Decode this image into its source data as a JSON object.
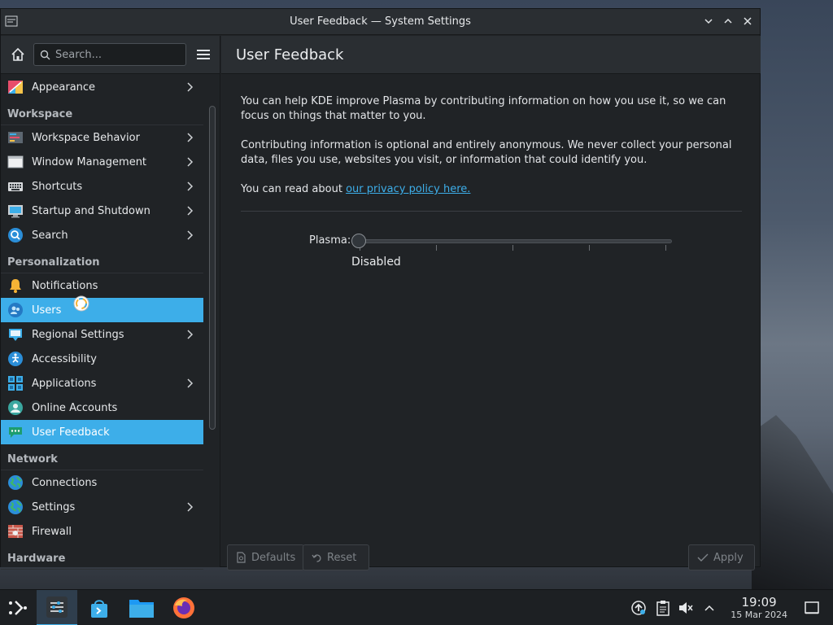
{
  "window": {
    "title": "User Feedback — System Settings"
  },
  "sidebar": {
    "search_placeholder": "Search...",
    "items": [
      {
        "label": "Appearance",
        "icon": "appearance-icon",
        "chevron": true
      },
      {
        "section": "Workspace"
      },
      {
        "label": "Workspace Behavior",
        "icon": "workspace-behavior-icon",
        "chevron": true
      },
      {
        "label": "Window Management",
        "icon": "window-management-icon",
        "chevron": true
      },
      {
        "label": "Shortcuts",
        "icon": "keyboard-icon",
        "chevron": true
      },
      {
        "label": "Startup and Shutdown",
        "icon": "startup-icon",
        "chevron": true
      },
      {
        "label": "Search",
        "icon": "search-icon",
        "chevron": true
      },
      {
        "section": "Personalization"
      },
      {
        "label": "Notifications",
        "icon": "bell-icon",
        "chevron": false
      },
      {
        "label": "Users",
        "icon": "users-icon",
        "chevron": false,
        "highlight": true
      },
      {
        "label": "Regional Settings",
        "icon": "regional-icon",
        "chevron": true
      },
      {
        "label": "Accessibility",
        "icon": "accessibility-icon",
        "chevron": false
      },
      {
        "label": "Applications",
        "icon": "applications-icon",
        "chevron": true
      },
      {
        "label": "Online Accounts",
        "icon": "online-accounts-icon",
        "chevron": false
      },
      {
        "label": "User Feedback",
        "icon": "user-feedback-icon",
        "chevron": false,
        "selected": true
      },
      {
        "section": "Network"
      },
      {
        "label": "Connections",
        "icon": "globe-icon",
        "chevron": false
      },
      {
        "label": "Settings",
        "icon": "globe-icon",
        "chevron": true
      },
      {
        "label": "Firewall",
        "icon": "firewall-icon",
        "chevron": false
      },
      {
        "section": "Hardware"
      }
    ]
  },
  "main": {
    "title": "User Feedback",
    "para1": "You can help KDE improve Plasma by contributing information on how you use it, so we can focus on things that matter to you.",
    "para2": "Contributing information is optional and entirely anonymous. We never collect your personal data, files you use, websites you visit, or information that could identify you.",
    "para3_prefix": "You can read about ",
    "para3_link": "our privacy policy here.",
    "slider_label": "Plasma:",
    "slider_value": "Disabled",
    "slider_position": 0,
    "slider_ticks": 5,
    "buttons": {
      "defaults": "Defaults",
      "reset": "Reset",
      "apply": "Apply"
    }
  },
  "taskbar": {
    "time": "19:09",
    "date": "15 Mar 2024"
  },
  "colors": {
    "accent": "#3daee9",
    "window_bg": "#202326",
    "header_bg": "#2a2e32"
  }
}
